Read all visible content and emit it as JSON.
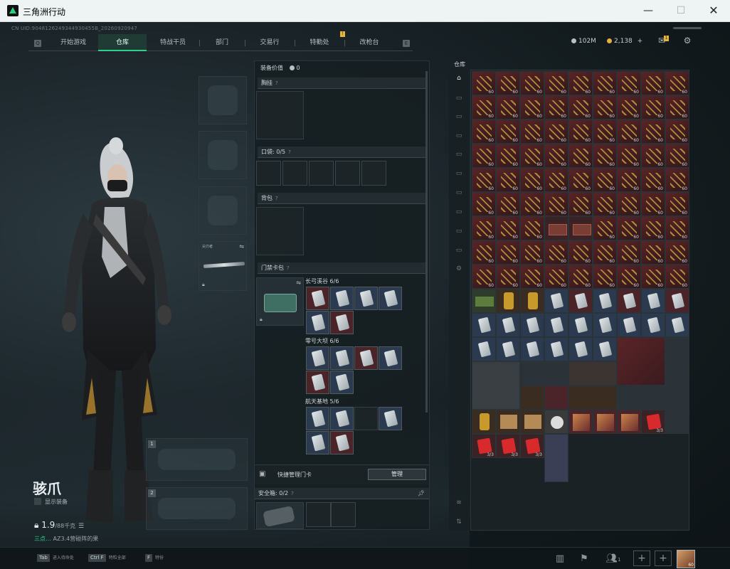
{
  "window": {
    "title": "三角洲行动"
  },
  "top": {
    "uid": "CN UID:9048126249344930455B_20260920947",
    "nav": [
      "开始游戏",
      "仓库",
      "特战干员",
      "部门",
      "交易行",
      "特勤处",
      "改枪台"
    ],
    "nav_key_left": "Q",
    "nav_key_right": "E",
    "nav_badge": "!",
    "currency_1": "102M",
    "currency_2": "2,138",
    "currency_plus": "+",
    "mail_badge": "1"
  },
  "character": {
    "name": "骇爪",
    "show_equip": "显示装备",
    "weight": "1.9",
    "weight_unit": "/88千克",
    "zone_note_prefix": "三点…",
    "zone_note": "AZ3.4营碰阵的果"
  },
  "equipment": {
    "slot_1": "1",
    "slot_2": "2",
    "melee_label": "尖刃者"
  },
  "middle": {
    "value_label": "装备价值",
    "value": "0",
    "chest_rig": "胸挂",
    "pocket_label": "口袋",
    "pocket_value": "0/5",
    "backpack": "背包",
    "key_card_bag": "门禁卡包",
    "group1_label": "长弓溪谷 6/6",
    "group2_label": "零号大坝 6/6",
    "group3_label": "航天基地 5/6",
    "quick_manage": "快捷管理门卡",
    "manage_btn": "管理",
    "safe_box": "安全箱",
    "safe_value": "0/2",
    "help": "?"
  },
  "warehouse": {
    "label": "仓库"
  },
  "bottom": {
    "hint1_key": "Tab",
    "hint1": "进入待命处",
    "hint2_key": "Ctrl F",
    "hint2": "特粒全部",
    "hint3_key": "F",
    "hint3": "特份",
    "friends": "1",
    "avatar_level": "60"
  }
}
